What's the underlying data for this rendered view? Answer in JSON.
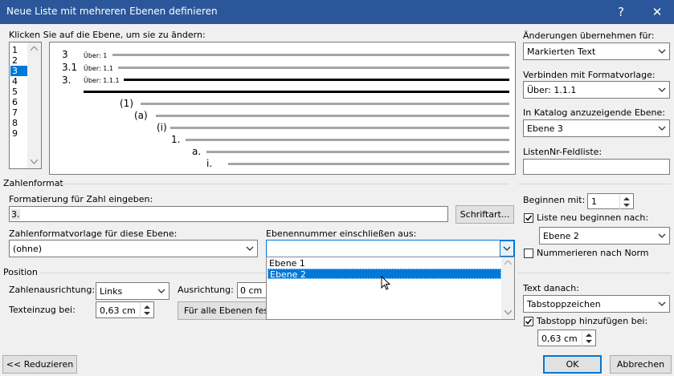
{
  "dialog": {
    "title": "Neue Liste mit mehreren Ebenen definieren",
    "help": "?",
    "close": "✕"
  },
  "levels": {
    "label": "Klicken Sie auf die Ebene, um sie zu ändern:",
    "items": [
      "1",
      "2",
      "3",
      "4",
      "5",
      "6",
      "7",
      "8",
      "9"
    ],
    "selected": "3"
  },
  "preview": {
    "row1": {
      "num": "3",
      "text": "Über: 1"
    },
    "row2": {
      "num": "3.1",
      "text": "Über: 1.1"
    },
    "row3": {
      "num": "3.",
      "text": "Über: 1.1.1"
    },
    "sub": [
      "(1)",
      "(a)",
      "(i)",
      "1.",
      "a.",
      "i."
    ]
  },
  "right_panel": {
    "apply_label": "Änderungen übernehmen für:",
    "apply_value": "Markierten Text",
    "link_style_label": "Verbinden mit Formatvorlage:",
    "link_style_value": "Über: 1.1.1",
    "gallery_level_label": "In Katalog anzuzeigende Ebene:",
    "gallery_level_value": "Ebene 3",
    "listnum_label": "ListenNr-Feldliste:",
    "listnum_value": "",
    "start_at_label": "Beginnen mit:",
    "start_at_value": "1",
    "restart_label": "Liste neu beginnen nach:",
    "restart_checked": true,
    "restart_value": "Ebene 2",
    "legal_label": "Nummerieren nach Norm",
    "legal_checked": false,
    "follow_label": "Text danach:",
    "follow_value": "Tabstoppzeichen",
    "tab_add_label": "Tabstopp hinzufügen bei:",
    "tab_add_checked": true,
    "tab_add_value": "0,63 cm"
  },
  "number_format": {
    "section": "Zahlenformat",
    "enter_label": "Formatierung für Zahl eingeben:",
    "enter_value": "3.",
    "font_button": "Schriftart...",
    "style_label": "Zahlenformatvorlage für diese Ebene:",
    "style_value": "(ohne)",
    "include_label": "Ebenennummer einschließen aus:",
    "include_value": "",
    "include_options": [
      "Ebene 1",
      "Ebene 2"
    ],
    "include_selected": "Ebene 2"
  },
  "position": {
    "section": "Position",
    "alignment_label": "Zahlenausrichtung:",
    "alignment_value": "Links",
    "aligned_at_label": "Ausrichtung:",
    "aligned_at_value": "0 cm",
    "indent_label": "Texteinzug bei:",
    "indent_value": "0,63 cm",
    "set_all_button": "Für alle Ebenen fest"
  },
  "footer": {
    "less_button": "<< Reduzieren",
    "ok_button": "OK",
    "cancel_button": "Abbrechen"
  },
  "colors": {
    "titlebar": "#2b579a",
    "accent": "#0078d7"
  }
}
